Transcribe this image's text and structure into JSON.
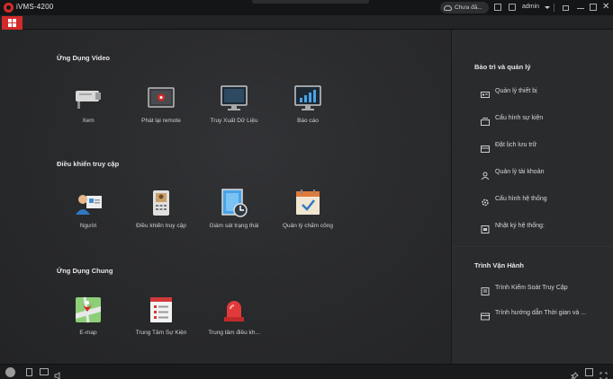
{
  "app": {
    "title": "iVMS-4200"
  },
  "titlebar": {
    "cloud_label": "Chưa đă...",
    "user": "admin",
    "icons": [
      "cloud-icon",
      "user-list-icon",
      "monitor-icon",
      "lock-icon",
      "minimize-icon",
      "maximize-icon",
      "close-icon"
    ]
  },
  "sections": {
    "video": {
      "title": "Ứng Dụng Video",
      "items": [
        {
          "label": "Xem",
          "icon": "camera-icon"
        },
        {
          "label": "Phát lại remote",
          "icon": "playback-icon"
        },
        {
          "label": "Truy Xuất Dữ Liệu",
          "icon": "data-retrieval-icon"
        },
        {
          "label": "Báo cáo",
          "icon": "report-chart-icon"
        }
      ]
    },
    "access": {
      "title": "Điều khiển truy cập",
      "items": [
        {
          "label": "Người",
          "icon": "person-card-icon"
        },
        {
          "label": "Điều khiển truy cập",
          "icon": "access-terminal-icon"
        },
        {
          "label": "Giám sát trạng thái",
          "icon": "door-monitor-icon"
        },
        {
          "label": "Quản lý chấm công",
          "icon": "attendance-calendar-icon"
        }
      ]
    },
    "common": {
      "title": "Ứng Dụng Chung",
      "items": [
        {
          "label": "E-map",
          "icon": "emap-icon"
        },
        {
          "label": "Trung Tâm Sự Kiện",
          "icon": "event-center-icon"
        },
        {
          "label": "Trung tâm điều kh...",
          "icon": "alarm-light-icon"
        }
      ]
    }
  },
  "right_panel": {
    "maintenance": {
      "title": "Bảo trì và quản lý",
      "items": [
        {
          "label": "Quản lý thiết bị",
          "icon": "device-icon"
        },
        {
          "label": "Cấu hình sự kiện",
          "icon": "event-config-icon"
        },
        {
          "label": "Đặt lịch lưu trữ",
          "icon": "storage-schedule-icon"
        },
        {
          "label": "Quản lý tài khoản",
          "icon": "account-icon"
        },
        {
          "label": "Cấu hình hệ thống",
          "icon": "system-config-icon"
        },
        {
          "label": "Nhật ký hệ thống:",
          "icon": "system-log-icon"
        }
      ]
    },
    "wizards": {
      "title": "Trình Vận Hành",
      "items": [
        {
          "label": "Trình Kiểm Soát Truy Cập",
          "icon": "access-wizard-icon"
        },
        {
          "label": "Trình hướng dẫn Thời gian và ...",
          "icon": "time-wizard-icon"
        }
      ]
    }
  },
  "statusbar": {
    "icons": [
      "alarm-icon",
      "trash-icon",
      "screen-icon",
      "volume-icon",
      "pin-icon",
      "window-icon",
      "fullscreen-icon"
    ]
  },
  "colors": {
    "accent": "#d22a2a",
    "background": "#232426",
    "panel": "#2a2b2d",
    "text": "#d8d8d8"
  }
}
